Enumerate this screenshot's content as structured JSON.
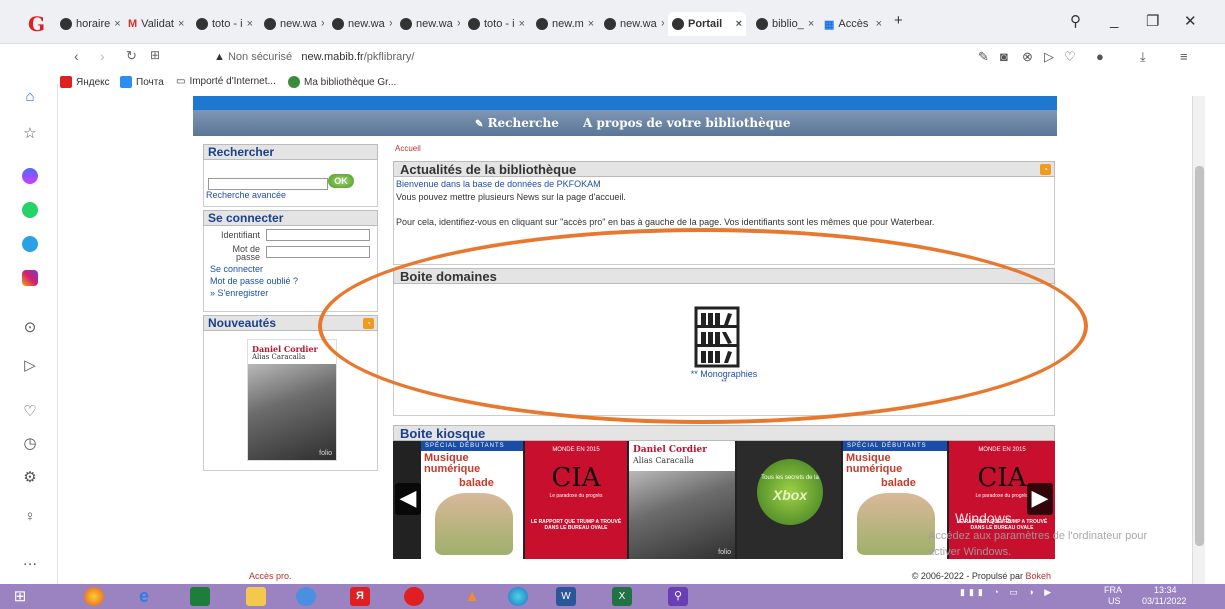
{
  "browser": {
    "tabs": [
      {
        "label": "horaire",
        "icon": "globe-icon"
      },
      {
        "label": "Validat",
        "icon": "gmail-icon"
      },
      {
        "label": "toto - i",
        "icon": "globe-icon"
      },
      {
        "label": "new.wa",
        "icon": "globe-icon"
      },
      {
        "label": "new.wa",
        "icon": "globe-icon"
      },
      {
        "label": "new.wa",
        "icon": "globe-icon"
      },
      {
        "label": "toto - i",
        "icon": "globe-icon"
      },
      {
        "label": "new.m",
        "icon": "globe-icon"
      },
      {
        "label": "new.wa",
        "icon": "globe-icon"
      },
      {
        "label": "Portail",
        "icon": "globe-icon",
        "active": true
      },
      {
        "label": "biblio_",
        "icon": "globe-icon"
      },
      {
        "label": "Accès",
        "icon": "grid-icon"
      }
    ],
    "security": "Non sécurisé",
    "url_host": "new.mabib.fr",
    "url_path": "/pkflibrary/",
    "bookmarks": [
      "Яндекс",
      "Почта",
      "Importé d'Internet...",
      "Ma bibliothèque Gr..."
    ]
  },
  "site": {
    "menu": {
      "search": "Recherche",
      "about": "A propos de votre bibliothèque"
    },
    "rechercher": {
      "title": "Rechercher",
      "ok": "OK",
      "advanced": "Recherche avancée"
    },
    "connect": {
      "title": "Se connecter",
      "id_label": "Identifiant",
      "pwd_label1": "Mot de",
      "pwd_label2": "passe",
      "login": "Se connecter",
      "forgot": "Mot de passe oublié ?",
      "register": "» S'enregistrer"
    },
    "nouveautes": {
      "title": "Nouveautés",
      "book_author": "Daniel Cordier",
      "book_title": "Alias Caracalla",
      "book_publisher": "folio"
    },
    "breadcrumb": "Accueil",
    "news": {
      "title": "Actualités de la bibliothèque",
      "line1": "Bienvenue dans la base de données de PKFOKAM",
      "line2": "Vous pouvez mettre plusieurs News sur la page d'accueil.",
      "line3": "Pour cela, identifiez-vous en cliquant sur \"accès pro\" en bas à gauche de la page. Vos identifiants sont les mêmes que pour Waterbear."
    },
    "domaines": {
      "title": "Boite domaines",
      "link": "** Monographies",
      "sub": "**"
    },
    "kiosque": {
      "title": "Boite kiosque",
      "books": [
        {
          "header": "SPÉCIAL DÉBUTANTS",
          "title": "Musique numérique",
          "sub": "balade",
          "color": "#c63b2a"
        },
        {
          "header": "MONDE EN 2015",
          "title": "CIA",
          "sub": "Le paradoxe du progrès",
          "footer": "LE RAPPORT QUE TRUMP A TROUVÉ DANS LE BUREAU OVALE",
          "color": "#c8102e"
        },
        {
          "header": "Daniel Cordier",
          "title": "Alias Caracalla",
          "sub": "folio",
          "color": "#ffffff"
        },
        {
          "header": "Tous les secrets de la",
          "title": "Xbox",
          "color": "#2d5b2a"
        },
        {
          "header": "SPÉCIAL DÉBUTANTS",
          "title": "Musique numérique",
          "sub": "balade",
          "color": "#c63b2a"
        },
        {
          "header": "MONDE EN 2015",
          "title": "CIA",
          "sub": "Le paradoxe du progrès",
          "footer": "LE RAPPORT QUE TRUMP A TROUVÉ DANS LE BUREAU OVALE",
          "color": "#c8102e"
        }
      ]
    },
    "footer": {
      "left": "Accès pro.",
      "right": "© 2006-2022 - Propulsé par",
      "brand": "Bokeh"
    }
  },
  "os": {
    "watermark1": "Windows",
    "watermark2": "Accédez aux paramètres de l'ordinateur pour",
    "watermark3": "activer Windows.",
    "lang": "FRA",
    "lang2": "US",
    "time": "13:34",
    "date": "03/11/2022"
  },
  "colors": {
    "accent": "#1e78d0",
    "annotation": "#e8782e",
    "link": "#1f4fa8"
  }
}
